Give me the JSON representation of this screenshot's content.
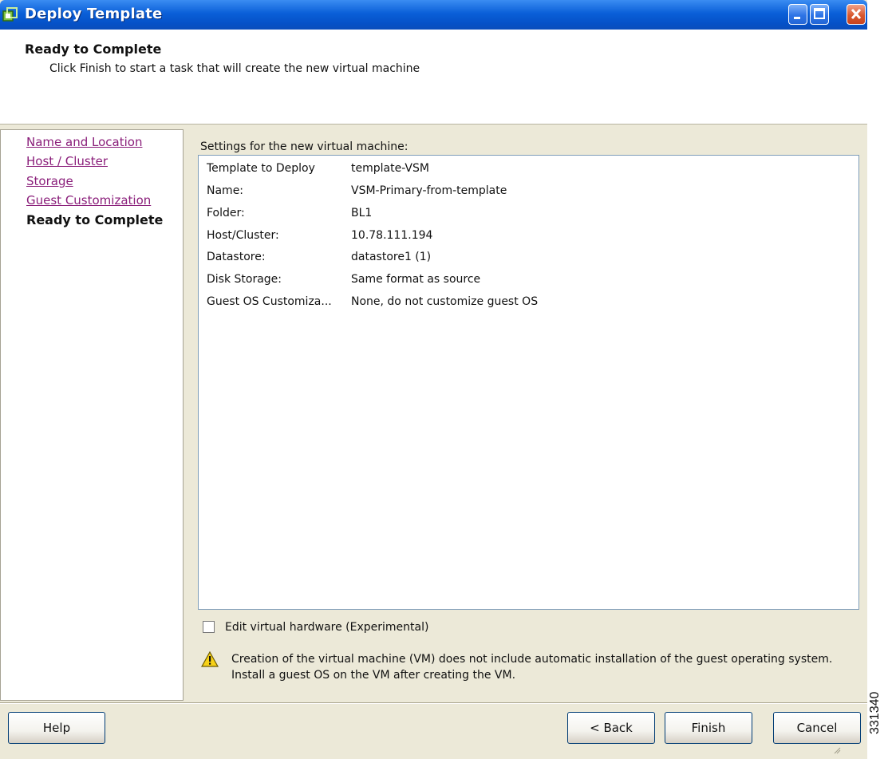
{
  "window": {
    "title": "Deploy Template",
    "icon": "vmware-template-icon",
    "controls": [
      "minimize-icon",
      "maximize-icon",
      "close-icon"
    ]
  },
  "header": {
    "title": "Ready to Complete",
    "subtitle": "Click Finish to start a task that will create the new virtual machine"
  },
  "nav": {
    "items": [
      {
        "label": "Name and Location",
        "state": "visited-link"
      },
      {
        "label": "Host / Cluster",
        "state": "visited-link"
      },
      {
        "label": "Storage",
        "state": "visited-link"
      },
      {
        "label": "Guest Customization",
        "state": "visited-link"
      },
      {
        "label": "Ready to Complete",
        "state": "current"
      }
    ]
  },
  "settings": {
    "label": "Settings for the new virtual machine:",
    "rows": [
      {
        "key": "Template to Deploy",
        "value": "template-VSM"
      },
      {
        "key": "Name:",
        "value": "VSM-Primary-from-template"
      },
      {
        "key": "Folder:",
        "value": "BL1"
      },
      {
        "key": "Host/Cluster:",
        "value": "10.78.111.194"
      },
      {
        "key": "Datastore:",
        "value": "datastore1 (1)"
      },
      {
        "key": "Disk Storage:",
        "value": "Same format as source"
      },
      {
        "key": "Guest OS Customiza...",
        "value": "None, do not customize guest OS"
      }
    ]
  },
  "options": {
    "edit_hardware_label": "Edit virtual hardware (Experimental)",
    "edit_hardware_checked": false
  },
  "warning": {
    "icon": "warning-icon",
    "text": "Creation of the virtual machine (VM) does not include automatic installation of the guest operating system. Install a guest OS on the VM after creating the VM."
  },
  "buttons": {
    "help": "Help",
    "back": "< Back",
    "finish": "Finish",
    "cancel": "Cancel"
  },
  "figure_id": "331340",
  "colors": {
    "titlebar": "#0a5fd8",
    "visited_link": "#8a1e7a",
    "dialog_bg": "#ece9d8"
  }
}
